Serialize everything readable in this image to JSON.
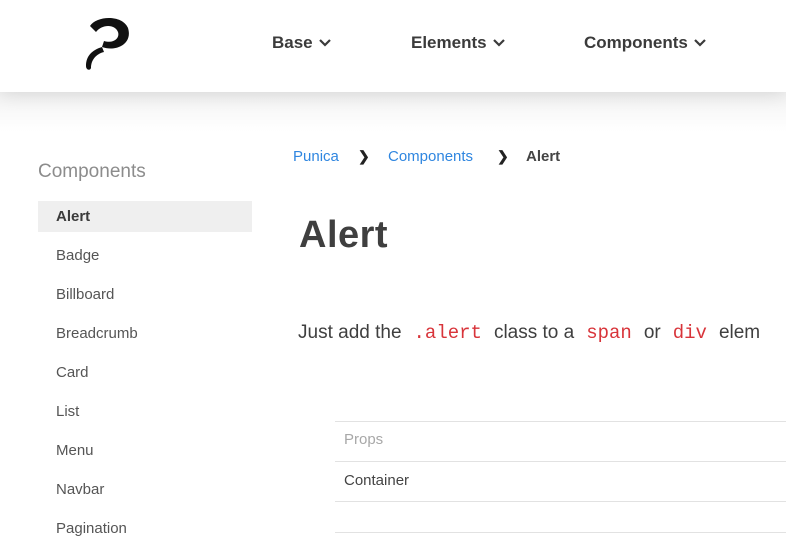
{
  "header": {
    "logo_icon": "punica-logo-icon",
    "nav": [
      {
        "label": "Base",
        "icon": "chevron-down-icon"
      },
      {
        "label": "Elements",
        "icon": "chevron-down-icon"
      },
      {
        "label": "Components",
        "icon": "chevron-down-icon"
      }
    ]
  },
  "sidebar": {
    "title": "Components",
    "active_item": "Alert",
    "items": [
      "Alert",
      "Badge",
      "Billboard",
      "Breadcrumb",
      "Card",
      "List",
      "Menu",
      "Navbar",
      "Pagination"
    ]
  },
  "breadcrumb": {
    "items": [
      "Punica",
      "Components",
      "Alert"
    ],
    "separator": "❯"
  },
  "main": {
    "title": "Alert",
    "intro": {
      "t1": "Just add the",
      "c1": ".alert",
      "t2": "class to a",
      "c2": "span",
      "t3": "or",
      "c3": "div",
      "t4": "elem"
    },
    "table": {
      "header": "Props",
      "rows": [
        "Container"
      ]
    }
  },
  "colors": {
    "link": "#2f86e0",
    "code": "#d8343a",
    "active_bg": "#efefef"
  }
}
